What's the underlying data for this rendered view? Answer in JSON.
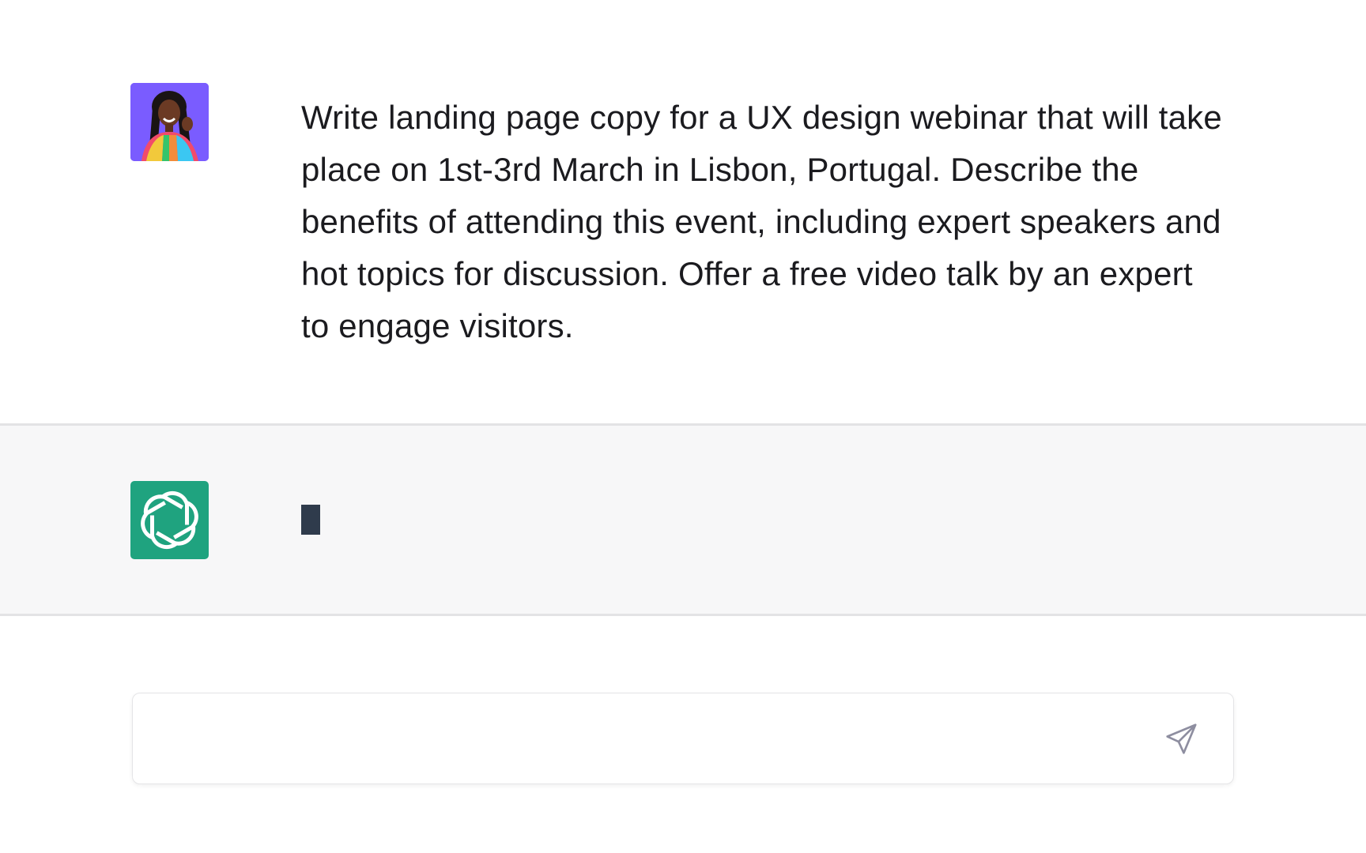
{
  "conversation": {
    "user": {
      "avatar_icon": "user-avatar-photo",
      "avatar_bg": "#7a5cff",
      "message": "Write landing page copy for a UX design webinar that will take place on 1st-3rd March in Lisbon, Portugal. Describe the benefits of attending this event, including expert speakers and hot topics for discussion. Offer a free video talk by an expert to engage visitors."
    },
    "assistant": {
      "avatar_icon": "openai-logo-icon",
      "avatar_bg": "#1fa37f",
      "message": "",
      "state": "typing-cursor"
    }
  },
  "composer": {
    "value": "",
    "placeholder": "",
    "send_icon": "send-icon"
  },
  "colors": {
    "user_row_bg": "#ffffff",
    "assistant_row_bg": "#f7f7f8",
    "text": "#1b1b1f",
    "cursor": "#2f3b4c"
  }
}
